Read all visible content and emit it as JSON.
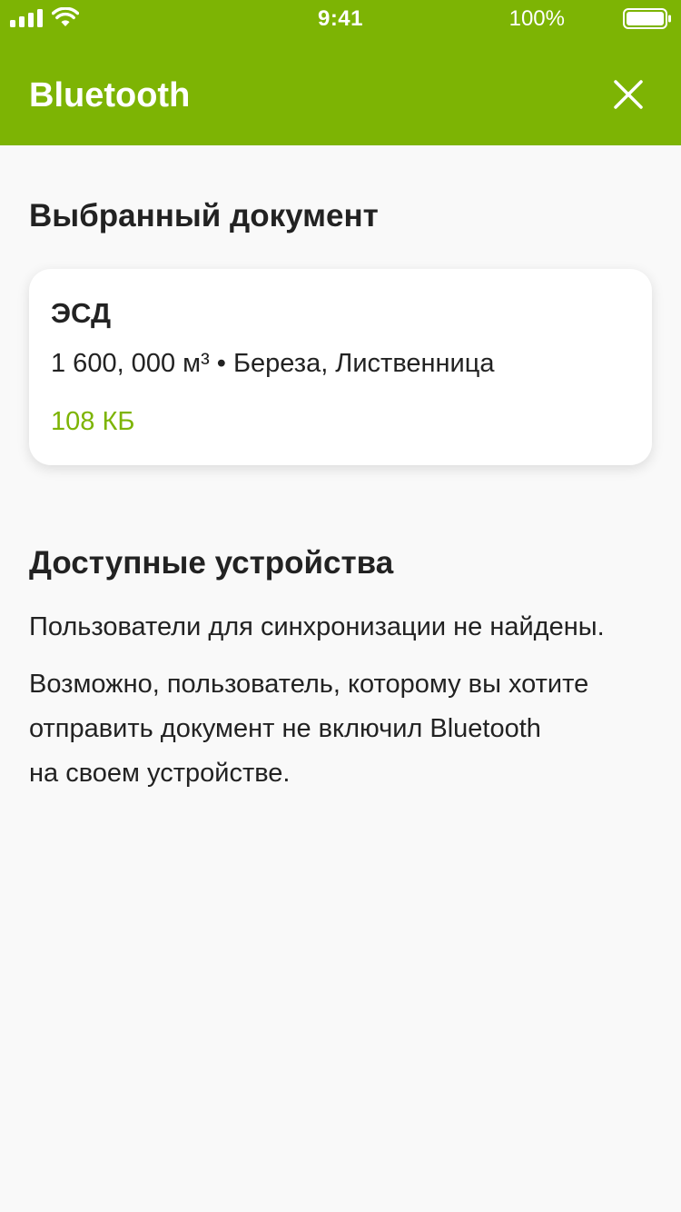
{
  "status_bar": {
    "time": "9:41",
    "battery_percent": "100%",
    "icons": [
      "signal-icon",
      "wifi-icon",
      "battery-icon"
    ]
  },
  "header": {
    "title": "Bluetooth",
    "close_icon": "close-icon"
  },
  "selected_document": {
    "section_title": "Выбранный документ",
    "name": "ЭСД",
    "details": "1 600, 000 м³ • Береза, Лиственница",
    "size": "108 КБ"
  },
  "devices": {
    "section_title": "Доступные устройства",
    "not_found": "Пользователи для синхронизации не найдены.",
    "hint_lines": [
      "Возможно, пользователь, которому вы хотите",
      "отправить документ не включил Bluetooth",
      "на своем устройстве."
    ]
  },
  "colors": {
    "brand": "#7db404",
    "background": "#f9f9f9",
    "text": "#222222"
  }
}
